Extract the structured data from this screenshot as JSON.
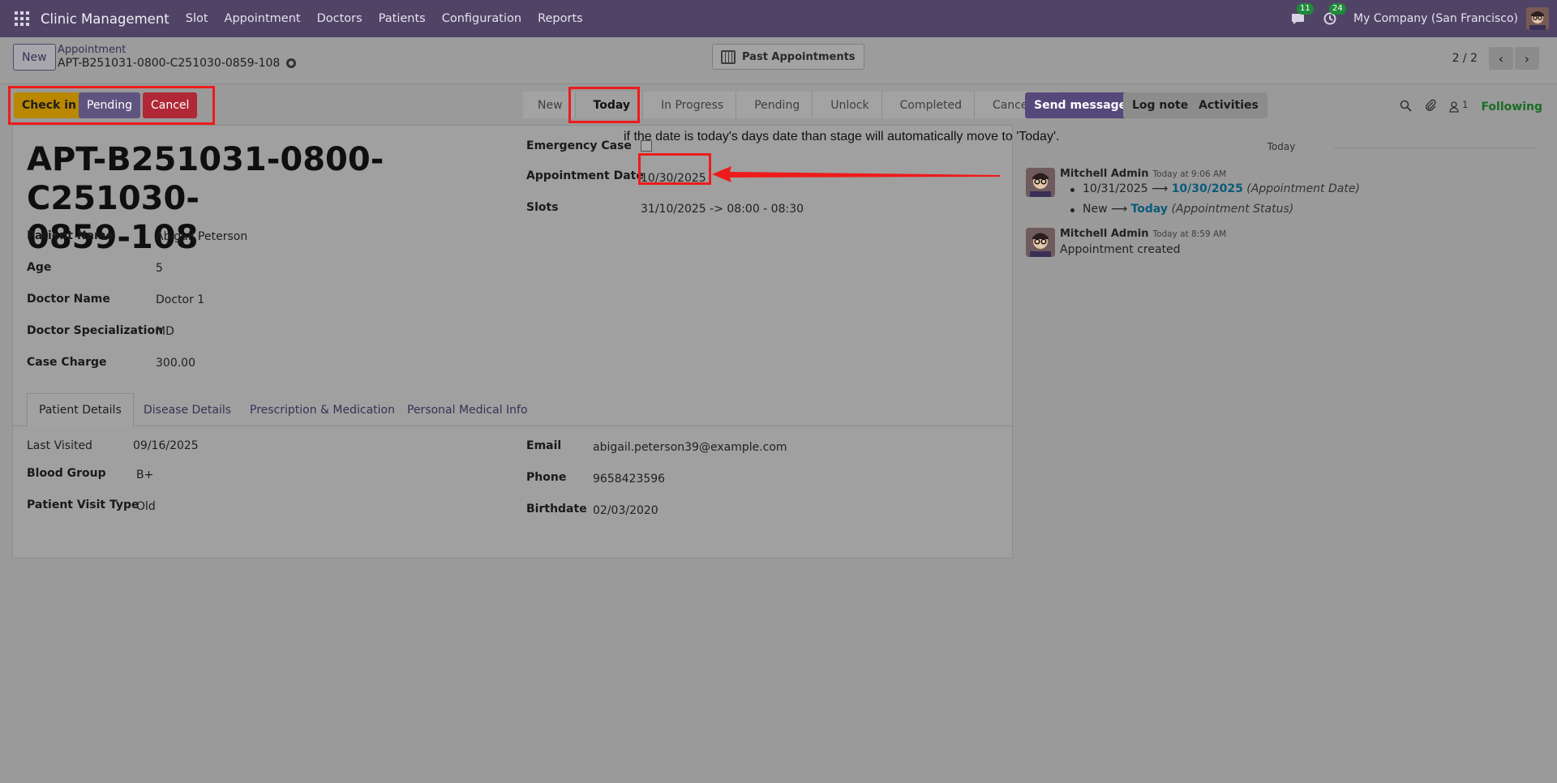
{
  "navbar": {
    "brand": "Clinic Management",
    "menu": [
      "Slot",
      "Appointment",
      "Doctors",
      "Patients",
      "Configuration",
      "Reports"
    ],
    "messages_count": "11",
    "activities_count": "24",
    "company": "My Company (San Francisco)"
  },
  "control": {
    "new_label": "New",
    "breadcrumb_parent": "Appointment",
    "breadcrumb_current": "APT-B251031-0800-C251030-0859-108",
    "past_appointments_label": "Past Appointments",
    "pager": "2 / 2"
  },
  "actions": {
    "checkin": "Check in",
    "pending": "Pending",
    "cancel": "Cancel"
  },
  "stages": [
    "New",
    "Today",
    "In Progress",
    "Pending",
    "Unlock",
    "Completed",
    "Cancelled"
  ],
  "active_stage": "Today",
  "chatter_buttons": {
    "send": "Send message",
    "log": "Log note",
    "activities": "Activities",
    "followers_count": "1",
    "following": "Following"
  },
  "record": {
    "title_line1": "APT-B251031-0800-C251030-",
    "title_line2": "0859-108",
    "fields_left": [
      {
        "label": "Patient Name",
        "value": "Abigail Peterson"
      },
      {
        "label": "Age",
        "value": "5"
      },
      {
        "label": "Doctor Name",
        "value": "Doctor 1"
      },
      {
        "label": "Doctor Specialization",
        "value": "MD"
      },
      {
        "label": "Case Charge",
        "value": "300.00"
      }
    ],
    "fields_right": [
      {
        "label": "Emergency Case",
        "value": ""
      },
      {
        "label": "Appointment Date",
        "value": "10/30/2025"
      },
      {
        "label": "Slots",
        "value": "31/10/2025 -> 08:00 - 08:30"
      }
    ]
  },
  "tabs": [
    "Patient Details",
    "Disease Details",
    "Prescription & Medication",
    "Personal Medical Info"
  ],
  "patient_details": {
    "left": [
      {
        "label": "Last Visited",
        "value": "09/16/2025"
      },
      {
        "label": "Blood Group",
        "value": "B+"
      },
      {
        "label": "Patient Visit Type",
        "value": "Old"
      }
    ],
    "right": [
      {
        "label": "Email",
        "value": "abigail.peterson39@example.com"
      },
      {
        "label": "Phone",
        "value": "9658423596"
      },
      {
        "label": "Birthdate",
        "value": "02/03/2020"
      }
    ]
  },
  "annotation": "if the date is today's days date than stage will automatically move to 'Today'.",
  "chatter": {
    "separator": "Today",
    "messages": [
      {
        "author": "Mitchell Admin",
        "time": "Today at 9:06 AM",
        "tracking": [
          {
            "old": "10/31/2025",
            "new": "10/30/2025",
            "field": "(Appointment Date)"
          },
          {
            "old": "New",
            "new": "Today",
            "field": "(Appointment Status)"
          }
        ]
      },
      {
        "author": "Mitchell Admin",
        "time": "Today at 8:59 AM",
        "body": "Appointment created"
      }
    ]
  },
  "colors": {
    "navbar": "#4f4466",
    "primary": "#55487a",
    "checkin": "#b98700",
    "cancel": "#b02836",
    "highlight_box": "#ee1b1b",
    "following": "#196d23"
  }
}
